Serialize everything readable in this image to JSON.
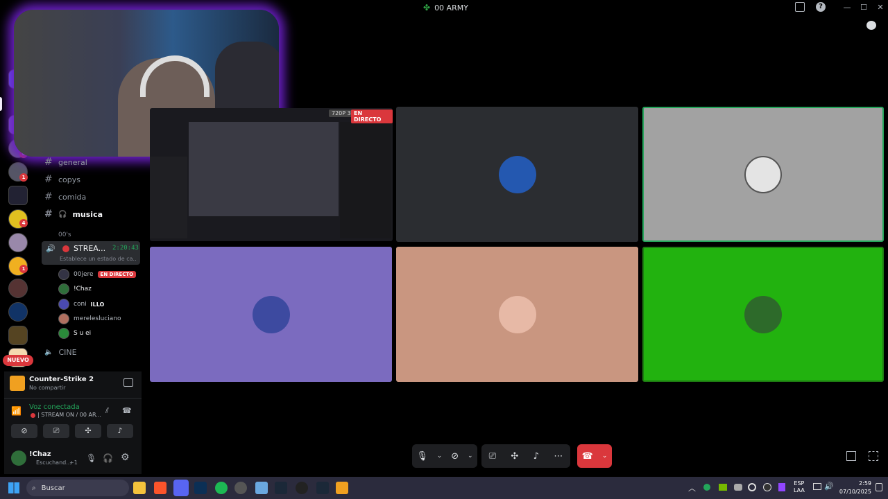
{
  "window": {
    "title": "00 ARMY",
    "controls": {
      "minimize": "—",
      "maximize": "☐",
      "close": "✕"
    }
  },
  "servers": {
    "badges": [
      "6",
      "1",
      "4",
      "1"
    ],
    "new_badge": "NUEVO"
  },
  "channels": {
    "items": [
      {
        "label": "general"
      },
      {
        "label": "copys"
      },
      {
        "label": "comida"
      },
      {
        "label": "musica"
      }
    ],
    "category": "00's",
    "voice_channel": {
      "name": "STREA...",
      "timer": "2:20:43",
      "status": "Establece un estado de ca..."
    },
    "members": [
      {
        "name": "00jere",
        "tag": "EN DIRECTO"
      },
      {
        "name": "!Chaz",
        "tag": ""
      },
      {
        "name": "coni",
        "tag": "ILLO"
      },
      {
        "name": "merelesluciano",
        "tag": ""
      },
      {
        "name": "S u ei",
        "tag": ""
      }
    ],
    "cine": "CINE"
  },
  "activity": {
    "game": "Counter-Strike 2",
    "sub": "No compartir"
  },
  "voice": {
    "status": "Voz conectada",
    "channel": "| STREAM ON / 00 AR..."
  },
  "user": {
    "name": "!Chaz",
    "status": "Escuchand...",
    "extra": "+1"
  },
  "stream_tile": {
    "quality": "720P 30",
    "live": "EN DIRECTO"
  },
  "taskbar": {
    "search_placeholder": "Buscar",
    "lang": "ESP",
    "layout": "LAA",
    "time": "2:59",
    "date": "07/10/2025"
  },
  "colors": {
    "accent_live": "#da373c",
    "voice_green": "#23a55a",
    "tile_gray": "#2b2d31",
    "tile_light": "#a2a2a2",
    "tile_purple": "#7b6bbf",
    "tile_pink": "#c99680",
    "tile_green": "#22b20f"
  }
}
